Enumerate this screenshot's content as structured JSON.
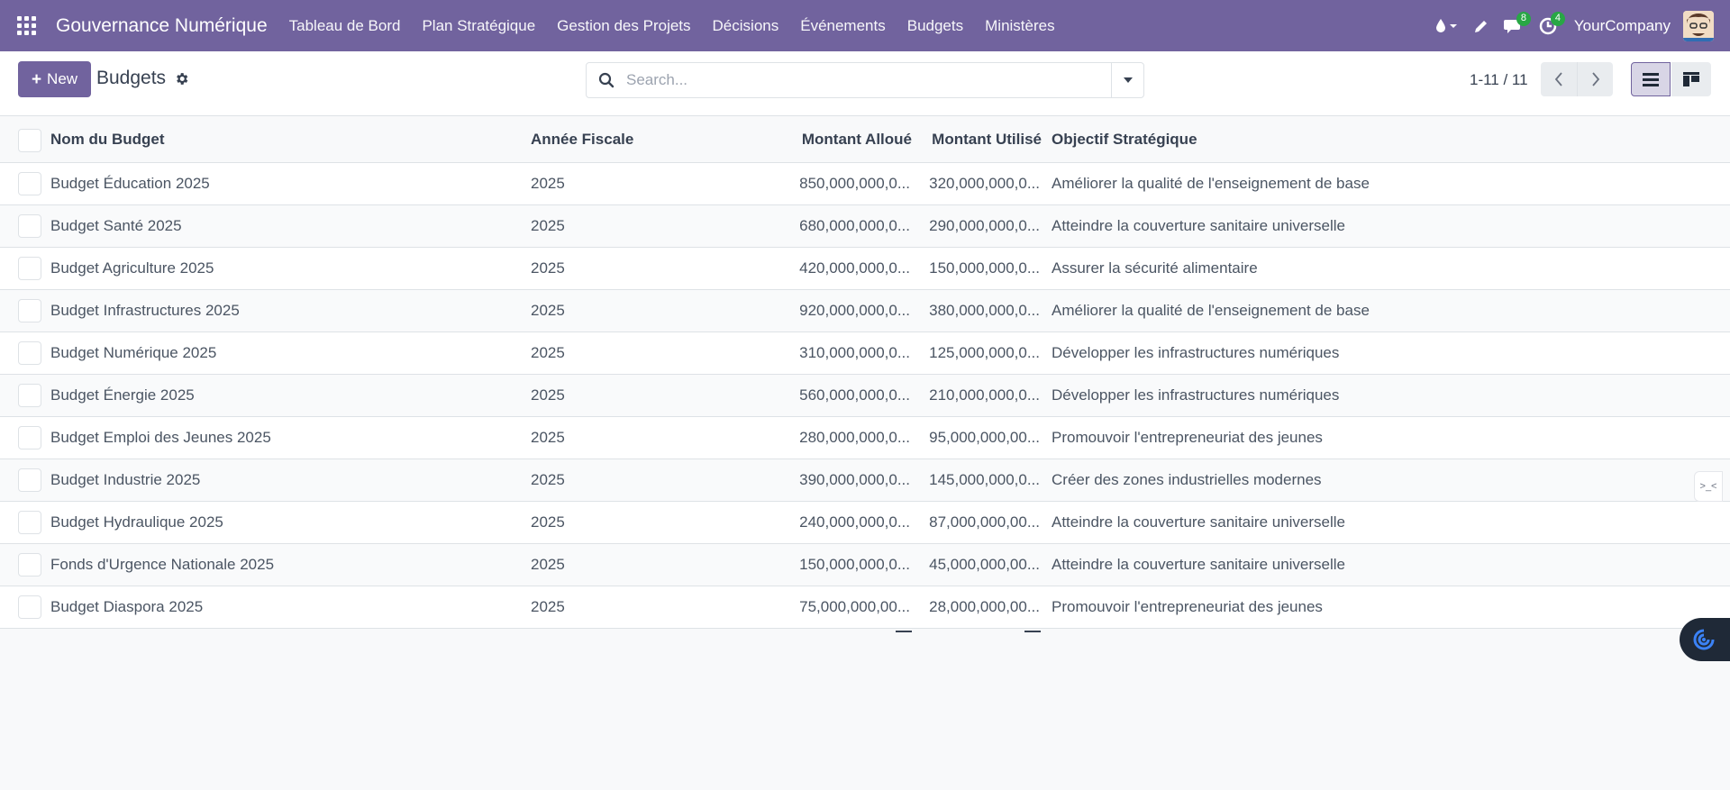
{
  "navbar": {
    "brand": "Gouvernance Numérique",
    "menu": [
      "Tableau de Bord",
      "Plan Stratégique",
      "Gestion des Projets",
      "Décisions",
      "Événements",
      "Budgets",
      "Ministères"
    ],
    "messages_count": "8",
    "activities_count": "4",
    "company": "YourCompany",
    "accent_color": "#71639e"
  },
  "control": {
    "new_label": "New",
    "title": "Budgets",
    "search_placeholder": "Search...",
    "pager": "1-11 / 11"
  },
  "table": {
    "columns": [
      "Nom du Budget",
      "Année Fiscale",
      "Montant Alloué",
      "Montant Utilisé",
      "Objectif Stratégique"
    ],
    "rows": [
      {
        "name": "Budget Éducation 2025",
        "year": "2025",
        "allocated": "850,000,000,0...",
        "used": "320,000,000,0...",
        "objective": "Améliorer la qualité de l'enseignement de base"
      },
      {
        "name": "Budget Santé 2025",
        "year": "2025",
        "allocated": "680,000,000,0...",
        "used": "290,000,000,0...",
        "objective": "Atteindre la couverture sanitaire universelle"
      },
      {
        "name": "Budget Agriculture 2025",
        "year": "2025",
        "allocated": "420,000,000,0...",
        "used": "150,000,000,0...",
        "objective": "Assurer la sécurité alimentaire"
      },
      {
        "name": "Budget Infrastructures 2025",
        "year": "2025",
        "allocated": "920,000,000,0...",
        "used": "380,000,000,0...",
        "objective": "Améliorer la qualité de l'enseignement de base"
      },
      {
        "name": "Budget Numérique 2025",
        "year": "2025",
        "allocated": "310,000,000,0...",
        "used": "125,000,000,0...",
        "objective": "Développer les infrastructures numériques"
      },
      {
        "name": "Budget Énergie 2025",
        "year": "2025",
        "allocated": "560,000,000,0...",
        "used": "210,000,000,0...",
        "objective": "Développer les infrastructures numériques"
      },
      {
        "name": "Budget Emploi des Jeunes 2025",
        "year": "2025",
        "allocated": "280,000,000,0...",
        "used": "95,000,000,00...",
        "objective": "Promouvoir l'entrepreneuriat des jeunes"
      },
      {
        "name": "Budget Industrie 2025",
        "year": "2025",
        "allocated": "390,000,000,0...",
        "used": "145,000,000,0...",
        "objective": "Créer des zones industrielles modernes"
      },
      {
        "name": "Budget Hydraulique 2025",
        "year": "2025",
        "allocated": "240,000,000,0...",
        "used": "87,000,000,00...",
        "objective": "Atteindre la couverture sanitaire universelle"
      },
      {
        "name": "Fonds d'Urgence Nationale 2025",
        "year": "2025",
        "allocated": "150,000,000,0...",
        "used": "45,000,000,00...",
        "objective": "Atteindre la couverture sanitaire universelle"
      },
      {
        "name": "Budget Diaspora 2025",
        "year": "2025",
        "allocated": "75,000,000,00...",
        "used": "28,000,000,00...",
        "objective": "Promouvoir l'entrepreneuriat des jeunes"
      }
    ]
  },
  "widgets": {
    "side_tab": ">_<"
  }
}
